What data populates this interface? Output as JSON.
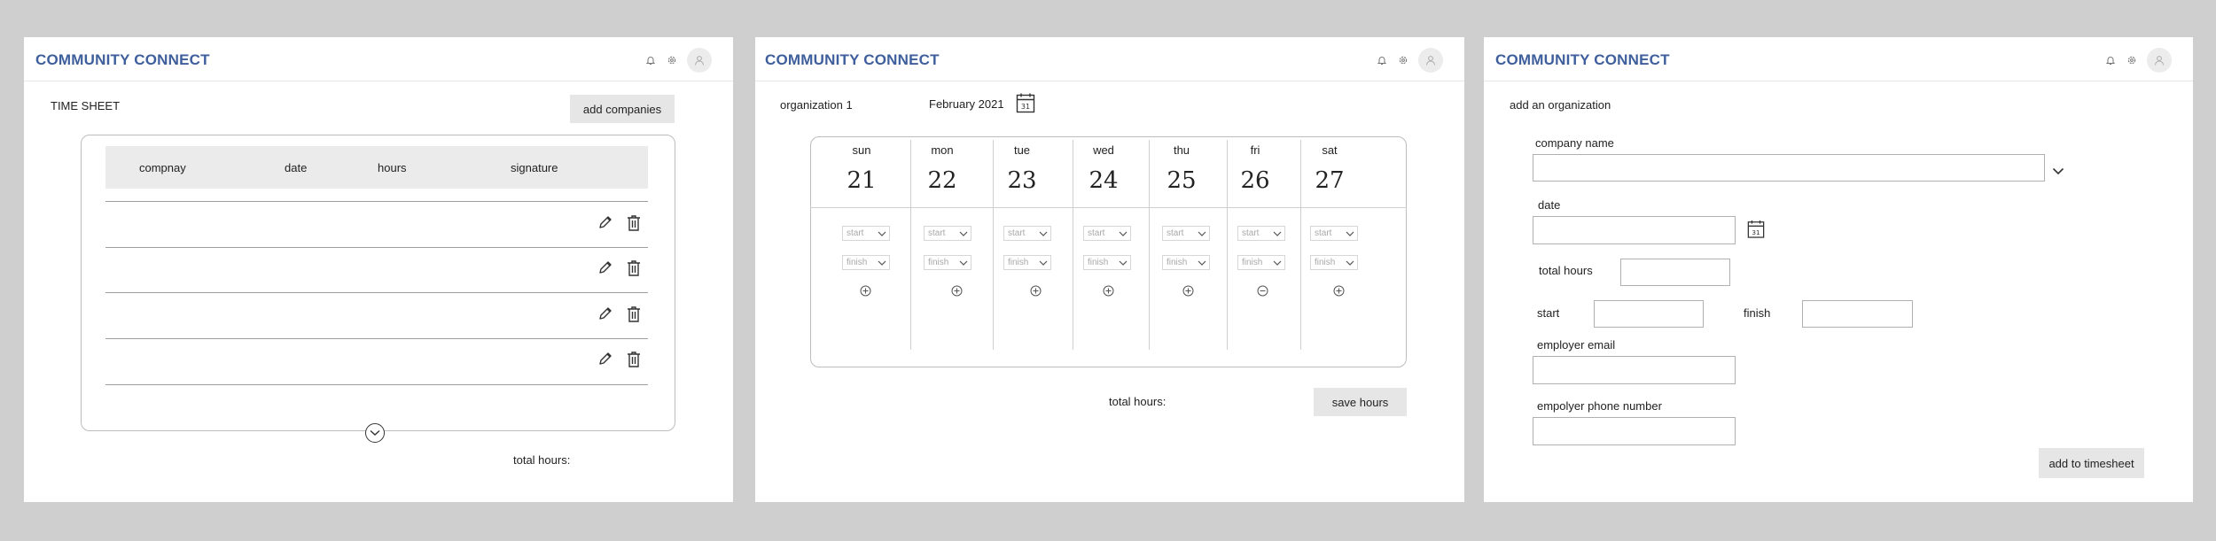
{
  "app": {
    "brand": "COMMUNITY CONNECT",
    "icons": [
      "bell-icon",
      "gear-icon",
      "user-avatar-icon"
    ],
    "brand_color": "#3e5f9c"
  },
  "timesheet": {
    "title": "TIME SHEET",
    "add_button": "add companies",
    "columns": [
      "compnay",
      "date",
      "hours",
      "signature"
    ],
    "rows": [
      {
        "actions": [
          "pencil-icon",
          "trash-icon"
        ]
      },
      {
        "actions": [
          "pencil-icon",
          "trash-icon"
        ]
      },
      {
        "actions": [
          "pencil-icon",
          "trash-icon"
        ]
      },
      {
        "actions": [
          "pencil-icon",
          "trash-icon"
        ]
      }
    ],
    "total_label": "total hours:"
  },
  "week": {
    "org": "organization 1",
    "month": "February 2021",
    "days": [
      {
        "name": "sun",
        "date": "21"
      },
      {
        "name": "mon",
        "date": "22"
      },
      {
        "name": "tue",
        "date": "23"
      },
      {
        "name": "wed",
        "date": "24"
      },
      {
        "name": "thu",
        "date": "25"
      },
      {
        "name": "fri",
        "date": "26"
      },
      {
        "name": "sat",
        "date": "27"
      }
    ],
    "start_label": "start",
    "finish_label": "finish",
    "total_label": "total hours:",
    "save_button": "save hours"
  },
  "org_form": {
    "title": "add an organization",
    "company_label": "company name",
    "date_label": "date",
    "calendar_day": "31",
    "total_label": "total hours",
    "start_label": "start",
    "finish_label": "finish",
    "email_label": "employer email",
    "phone_label": "empolyer phone number",
    "submit_button": "add to timesheet"
  }
}
